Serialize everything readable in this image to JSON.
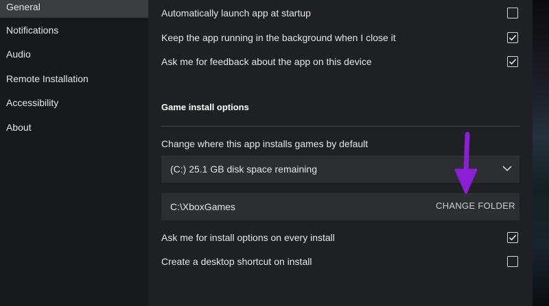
{
  "sidebar": {
    "items": [
      {
        "label": "General",
        "active": true
      },
      {
        "label": "Notifications"
      },
      {
        "label": "Audio"
      },
      {
        "label": "Remote Installation"
      },
      {
        "label": "Accessibility"
      },
      {
        "label": "About"
      }
    ]
  },
  "general": {
    "launch_startup": {
      "label": "Automatically launch app at startup",
      "checked": false
    },
    "keep_running": {
      "label": "Keep the app running in the background when I close it",
      "checked": true
    },
    "feedback": {
      "label": "Ask me for feedback about the app on this device",
      "checked": true
    }
  },
  "game_install": {
    "section_title": "Game install options",
    "location_label": "Change where this app installs games by default",
    "drive_select": {
      "value": "(C:) 25.1 GB disk space remaining"
    },
    "install_path": "C:\\XboxGames",
    "change_folder_label": "CHANGE FOLDER",
    "ask_options": {
      "label": "Ask me for install options on every install",
      "checked": true
    },
    "desktop_shortcut": {
      "label": "Create a desktop shortcut on install",
      "checked": false
    }
  },
  "colors": {
    "annotation_arrow": "#8a1fd6",
    "accent_selected": "#3a3c40"
  },
  "icons": {
    "checkmark": "checkmark-icon",
    "dropdown": "chevron-down-icon",
    "annotation": "arrow-down-icon"
  }
}
